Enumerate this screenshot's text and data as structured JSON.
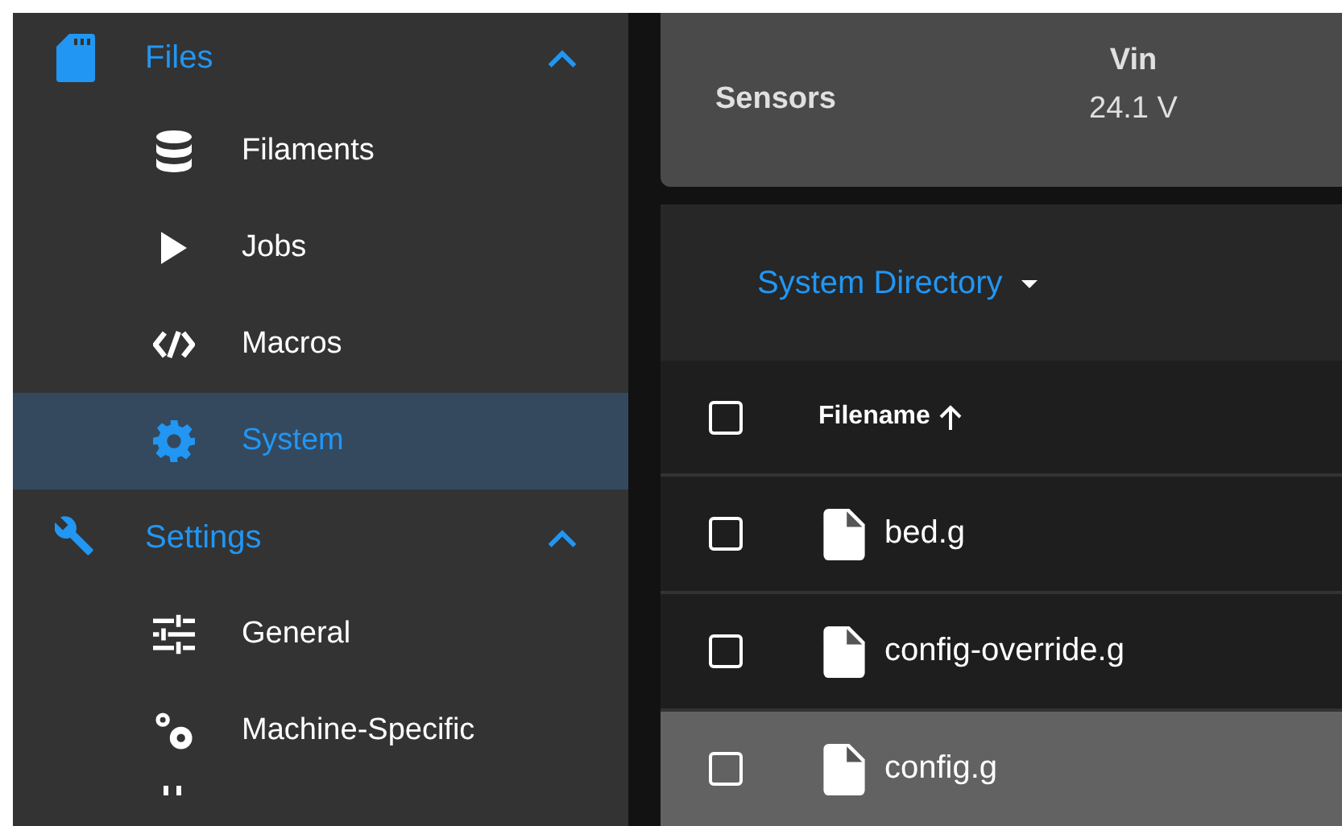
{
  "sidebar": {
    "groups": [
      {
        "label": "Files",
        "expanded": true,
        "children": [
          {
            "label": "Filaments",
            "selected": false
          },
          {
            "label": "Jobs",
            "selected": false
          },
          {
            "label": "Macros",
            "selected": false
          },
          {
            "label": "System",
            "selected": true
          }
        ]
      },
      {
        "label": "Settings",
        "expanded": true,
        "children": [
          {
            "label": "General",
            "selected": false
          },
          {
            "label": "Machine-Specific",
            "selected": false
          }
        ]
      }
    ]
  },
  "sensors": {
    "title": "Sensors",
    "readings": [
      {
        "label": "Vin",
        "value": "24.1 V"
      }
    ]
  },
  "files": {
    "directory": "System Directory",
    "all_checked": false,
    "columns": [
      {
        "label": "Filename",
        "sort_ascending": true
      }
    ],
    "rows": [
      {
        "name": "bed.g",
        "checked": false,
        "selected": false
      },
      {
        "name": "config-override.g",
        "checked": false,
        "selected": false
      },
      {
        "name": "config.g",
        "checked": false,
        "selected": true
      }
    ]
  }
}
